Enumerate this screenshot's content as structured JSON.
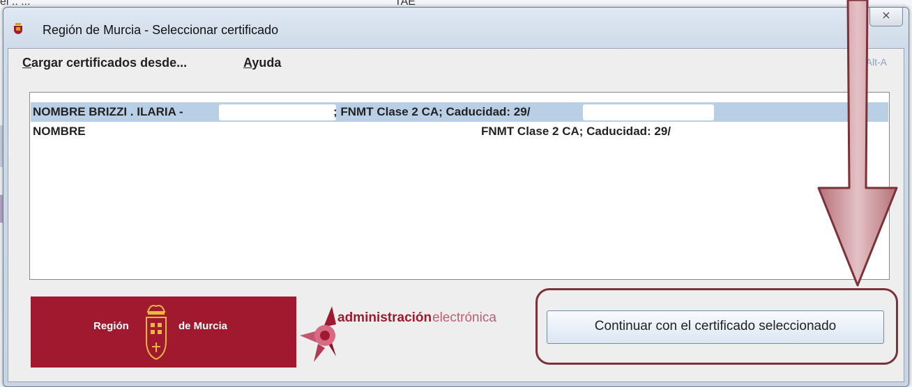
{
  "background": {
    "left_text": "el .. ... ",
    "middle_text": "TAE"
  },
  "window": {
    "title": "Región de Murcia - Seleccionar certificado",
    "close_label": "⨯"
  },
  "menu": {
    "items": [
      {
        "first": "C",
        "rest": "argar certificados desde..."
      },
      {
        "first": "A",
        "rest": "yuda"
      }
    ],
    "shortcut_hint": "Alt-A"
  },
  "certificates": [
    {
      "name": "NOMBRE BRIZZI . ILARIA -",
      "issuer": "; FNMT Clase 2 CA; Caducidad: 29/",
      "selected": true
    },
    {
      "name": "NOMBRE",
      "issuer": "FNMT Clase 2 CA; Caducidad: 29/",
      "selected": false
    }
  ],
  "logos": {
    "murcia": {
      "left": "Región",
      "right": "de Murcia"
    },
    "ae": {
      "bold": "administración",
      "light": "electrónica"
    }
  },
  "actions": {
    "continue_label": "Continuar con el certificado seleccionado"
  },
  "colors": {
    "accent": "#a0192e",
    "selection": "#b8cfe5",
    "annotation": "#7a3238"
  }
}
